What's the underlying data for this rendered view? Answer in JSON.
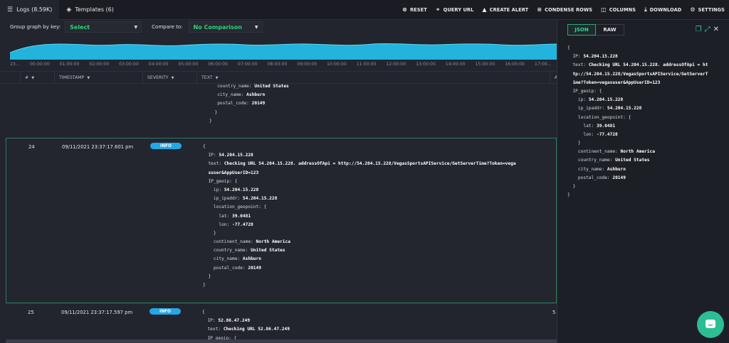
{
  "tabs": [
    {
      "label": "Logs (8.59K)",
      "icon": "logs-icon"
    },
    {
      "label": "Templates (6)",
      "icon": "templates-icon"
    }
  ],
  "actions": [
    {
      "label": "RESET",
      "icon": "reset-icon"
    },
    {
      "label": "QUERY URL",
      "icon": "link-icon"
    },
    {
      "label": "CREATE ALERT",
      "icon": "bell-icon"
    },
    {
      "label": "CONDENSE ROWS",
      "icon": "rows-icon"
    },
    {
      "label": "COLUMNS",
      "icon": "columns-icon"
    },
    {
      "label": "DOWNLOAD",
      "icon": "download-icon"
    },
    {
      "label": "SETTINGS",
      "icon": "gear-icon"
    }
  ],
  "filters": {
    "group_label": "Group graph by key:",
    "group_value": "Select",
    "compare_label": "Compare to:",
    "compare_value": "No Comparison"
  },
  "time_axis": [
    "23...",
    "00:00:00",
    "01:00:00",
    "02:00:00",
    "03:00:00",
    "04:00:00",
    "05:00:00",
    "06:00:00",
    "07:00:00",
    "08:00:00",
    "09:00:00",
    "10:00:00",
    "11:00:00",
    "12:00:00",
    "13:00:00",
    "14:00:00",
    "15:00:00",
    "16:00:00",
    "17:00..."
  ],
  "table": {
    "columns": [
      "#",
      "TIMESTAMP",
      "SEVERITY",
      "TEXT",
      "A"
    ]
  },
  "row_prev_tail": [
    {
      "k": "country_name",
      "v": "United States"
    },
    {
      "k": "city_name",
      "v": "Ashburn"
    },
    {
      "k": "postal_code",
      "v": "20149"
    }
  ],
  "rows": [
    {
      "num": "24",
      "timestamp": "09/11/2021 23:37:17.601 pm",
      "severity": "INFO",
      "ip": "54.204.15.228",
      "text_l1": "Checking URL 54.204.15.228. addressOfApi = http://54.204.15.228/VegasSportsAPIService/GetServerTime?Token=vega",
      "text_l2": "suser&AppUserID=123",
      "geo_ip": "54.204.15.228",
      "geo_ipaddr": "54.204.15.228",
      "lat": "39.0481",
      "lon": "-77.4728",
      "continent": "North America",
      "country": "United States",
      "city": "Ashburn",
      "postal": "20149"
    },
    {
      "num": "25",
      "timestamp": "09/11/2021 23:37:17.597 pm",
      "severity": "INFO",
      "ip": "52.86.47.249",
      "text_l1": "Checking URL 52.86.47.249",
      "next_partial": "IP_geoip: {",
      "a_col": "5"
    }
  ],
  "panel": {
    "tab_json": "JSON",
    "tab_raw": "RAW",
    "ip": "54.204.15.228",
    "text_l1": "Checking URL 54.204.15.228. addressOfApi = ht",
    "text_l2": "tp://54.204.15.228/VegasSportsAPIService/GetServerT",
    "text_l3": "ime?Token=vegasuser&AppUserID=123",
    "geo_ip": "54.204.15.228",
    "geo_ipaddr": "54.204.15.228",
    "lat": "39.0481",
    "lon": "-77.4728",
    "continent": "North America",
    "country": "United States",
    "city": "Ashburn",
    "postal": "20149"
  },
  "colors": {
    "accent": "#2ed4a0",
    "badge": "#23a8e6",
    "graph": "#22b4dc"
  }
}
